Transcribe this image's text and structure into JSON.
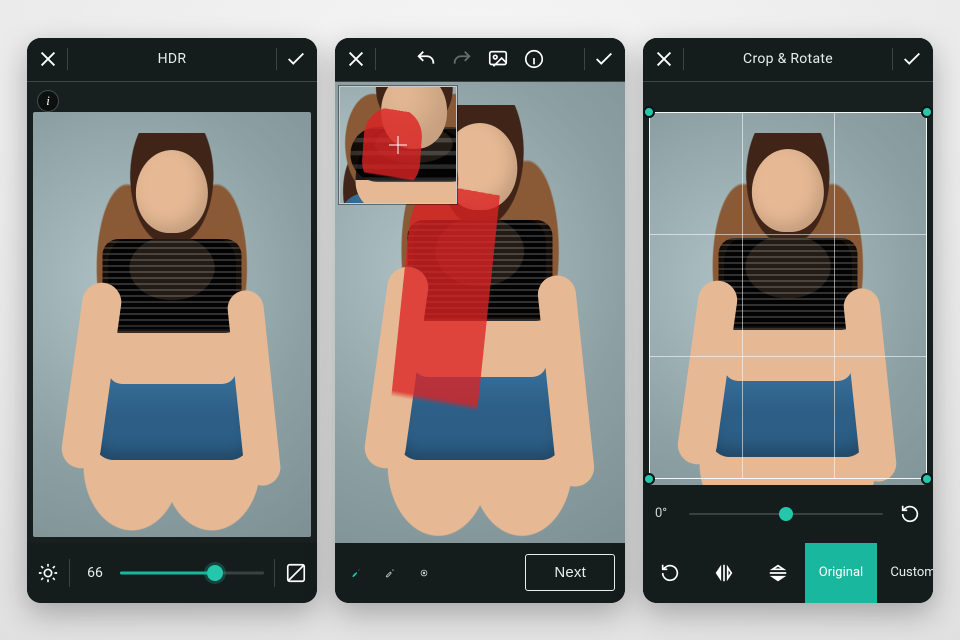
{
  "screens": {
    "hdr": {
      "title": "HDR",
      "valueLabel": "66",
      "sliderPercent": 66
    },
    "heal": {
      "nextLabel": "Next"
    },
    "crop": {
      "title": "Crop & Rotate",
      "degree": "0°",
      "rotatePercent": 50,
      "tabs": {
        "original": "Original",
        "custom": "Custom"
      }
    }
  }
}
